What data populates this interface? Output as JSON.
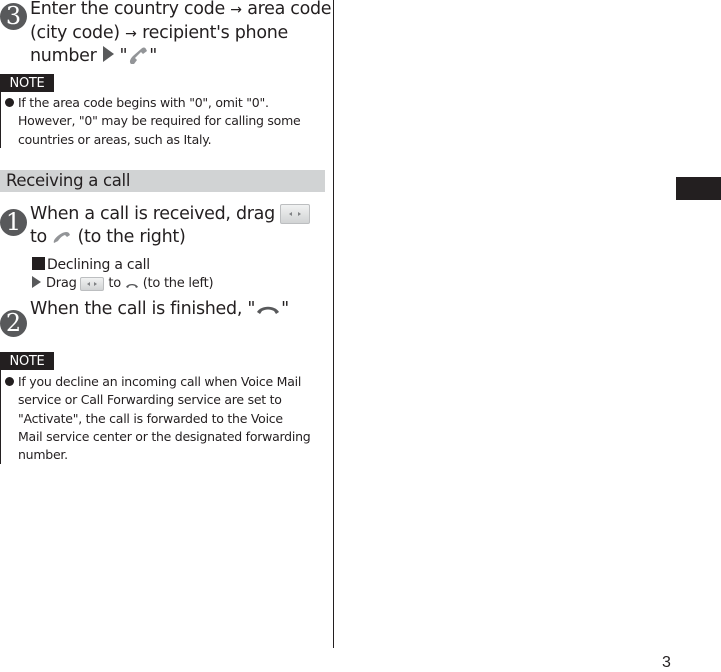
{
  "step3": {
    "number": "3",
    "line1_a": "Enter the country code",
    "arrow": "→",
    "line1_b": "area code",
    "line2_a": "(city code)",
    "line2_b": "recipient's phone",
    "line3_a": "number",
    "quote_open": "\"",
    "quote_close": "\""
  },
  "note1": {
    "label": "NOTE",
    "lines": [
      "If the area code begins with \"0\", omit \"0\".",
      "However, \"0\" may be required for calling some",
      "countries or areas, such as Italy."
    ]
  },
  "section": {
    "title": "Receiving a call"
  },
  "step1": {
    "number": "1",
    "line1": "When a call is received, drag",
    "line2_a": "to",
    "line2_b": "(to the right)",
    "declining_title": "Declining a call",
    "declining_a": "Drag",
    "declining_b": "to",
    "declining_c": "(to the left)"
  },
  "step2": {
    "number": "2",
    "text_a": "When the call is finished, \"",
    "text_b": "\""
  },
  "note2": {
    "label": "NOTE",
    "lines": [
      "If you decline an incoming call when Voice Mail",
      "service or Call Forwarding service are set to",
      "\"Activate\", the call is forwarded to the Voice",
      "Mail service center or the designated forwarding",
      "number."
    ]
  },
  "page": {
    "number": "3"
  },
  "colors": {
    "text": "#231f20",
    "section_bg": "#d1d3d4",
    "step_circle": "#58595b",
    "icon_gray": "#939598"
  }
}
